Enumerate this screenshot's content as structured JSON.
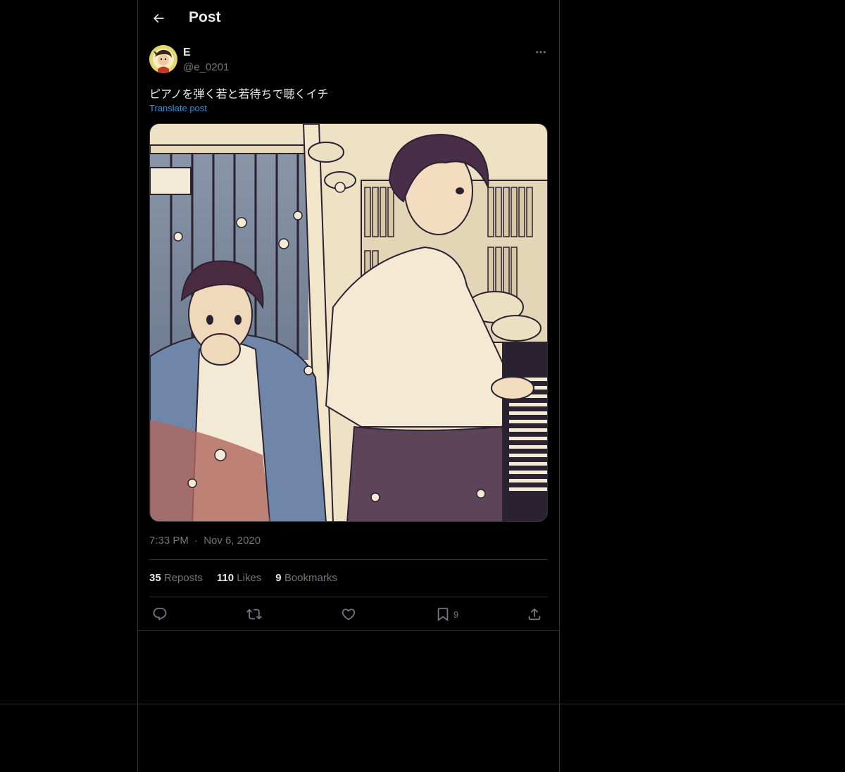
{
  "header": {
    "title": "Post"
  },
  "author": {
    "display_name": "E",
    "handle": "@e_0201"
  },
  "post": {
    "text": "ピアノを弾く若と若待ちで聴くイチ",
    "translate_label": "Translate post",
    "time": "7:33 PM",
    "separator": "·",
    "date": "Nov 6, 2020"
  },
  "stats": {
    "reposts_count": "35",
    "reposts_label": "Reposts",
    "likes_count": "110",
    "likes_label": "Likes",
    "bookmarks_count": "9",
    "bookmarks_label": "Bookmarks"
  },
  "actions": {
    "bookmark_count": "9"
  },
  "icons": {
    "back": "arrow-left-icon",
    "more": "more-horizontal-icon",
    "reply": "reply-icon",
    "repost": "repost-icon",
    "like": "heart-icon",
    "bookmark": "bookmark-icon",
    "share": "share-icon"
  },
  "colors": {
    "background": "#000000",
    "text": "#e7e9ea",
    "muted": "#71767b",
    "link": "#1d9bf0",
    "border": "#2f3336"
  }
}
